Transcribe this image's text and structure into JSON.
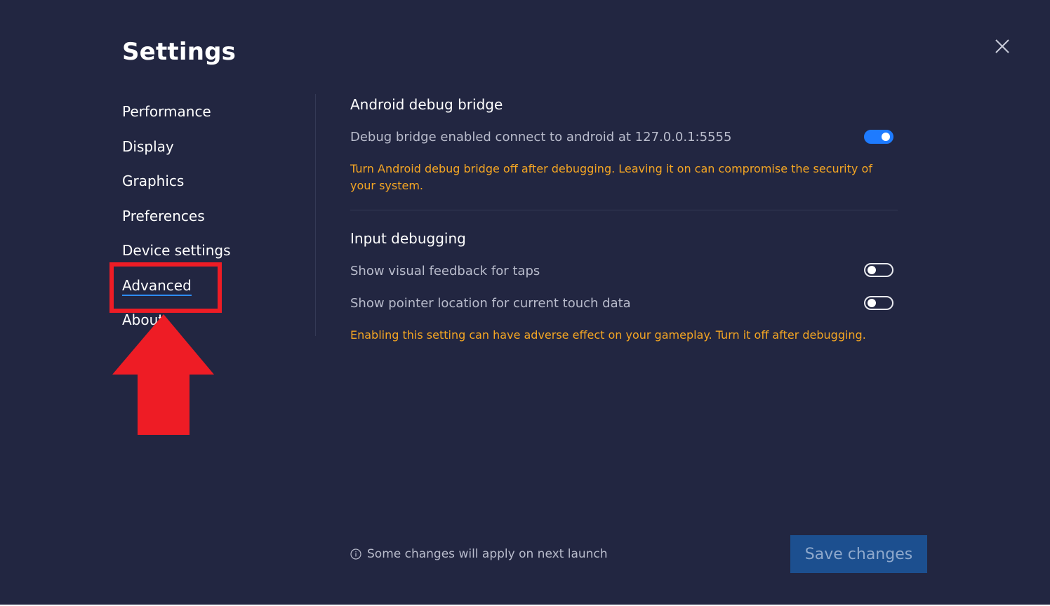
{
  "window": {
    "title": "Settings"
  },
  "sidebar": {
    "items": [
      {
        "label": "Performance",
        "active": false
      },
      {
        "label": "Display",
        "active": false
      },
      {
        "label": "Graphics",
        "active": false
      },
      {
        "label": "Preferences",
        "active": false
      },
      {
        "label": "Device settings",
        "active": false
      },
      {
        "label": "Advanced",
        "active": true
      },
      {
        "label": "About",
        "active": false
      }
    ]
  },
  "advanced": {
    "adb": {
      "title": "Android debug bridge",
      "toggle_label": "Debug bridge enabled connect to android at 127.0.0.1:5555",
      "toggle_on": true,
      "warning": "Turn Android debug bridge off after debugging. Leaving it on can compromise the security of your system."
    },
    "input_debugging": {
      "title": "Input debugging",
      "tap_feedback_label": "Show visual feedback for taps",
      "tap_feedback_on": false,
      "pointer_location_label": "Show pointer location for current touch data",
      "pointer_location_on": false,
      "warning": "Enabling this setting can have adverse effect on your gameplay. Turn it off after  debugging."
    }
  },
  "footer": {
    "note": "Some changes will apply on next launch",
    "save_label": "Save changes"
  },
  "colors": {
    "background": "#222641",
    "accent": "#1e7bff",
    "warning": "#f5a623",
    "annotation": "#ee1c25"
  },
  "icons": {
    "close": "close-icon",
    "info": "info-icon"
  }
}
